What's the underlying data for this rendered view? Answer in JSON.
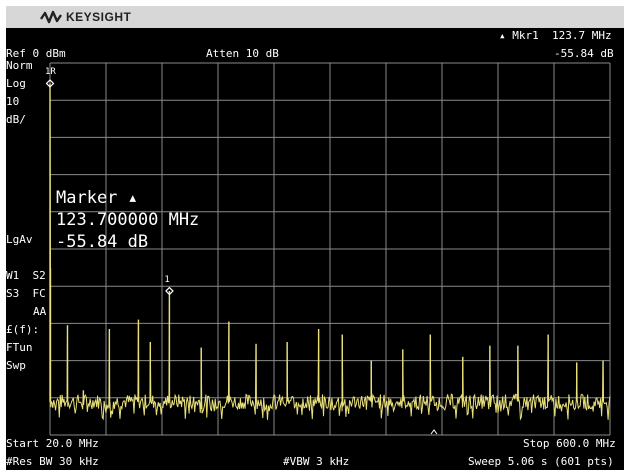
{
  "brand": {
    "name": "KEYSIGHT",
    "logo_icon": "keysight-wave-icon"
  },
  "header": {
    "ref": "Ref 0 dBm",
    "atten": "Atten 10 dB",
    "marker_readout_freq": "▴ Mkr1  123.7 MHz",
    "marker_readout_level": "-55.84 dB"
  },
  "left_panel": {
    "norm": "Norm",
    "log": "Log",
    "scale_value": "10",
    "scale_unit": "dB/",
    "avg": "LgAv",
    "w1s2": "W1  S2",
    "s3fc": "S3  FC",
    "aa": "AA",
    "ff": "£(f):",
    "ftun": "FTun",
    "swp": "Swp"
  },
  "marker_box": {
    "title": "Marker ▴",
    "freq": "123.700000 MHz",
    "level": "-55.84 dB"
  },
  "markers": [
    {
      "label": "1R",
      "freq_mhz": 20.0,
      "level_db": -5.5
    },
    {
      "label": "1",
      "freq_mhz": 143.7,
      "level_db": -61.3
    }
  ],
  "footer": {
    "start": "Start 20.0 MHz",
    "stop": "Stop 600.0 MHz",
    "rbw": "#Res BW 30 kHz",
    "vbw": "#VBW 3 kHz",
    "sweep": "Sweep 5.06 s (601 pts)"
  },
  "chart_data": {
    "type": "line",
    "x_range_mhz": [
      20,
      600
    ],
    "y_range_dbm": [
      0,
      -100
    ],
    "grid": true,
    "trace_color": "#e8e07a",
    "peaks": [
      {
        "freq_mhz": 20.0,
        "level_dbm": -5.5
      },
      {
        "freq_mhz": 20.5,
        "level_dbm": -55.0
      },
      {
        "freq_mhz": 38.1,
        "level_dbm": -70.5
      },
      {
        "freq_mhz": 54.6,
        "level_dbm": -88.0
      },
      {
        "freq_mhz": 81.5,
        "level_dbm": -71.5
      },
      {
        "freq_mhz": 111.6,
        "level_dbm": -69.0
      },
      {
        "freq_mhz": 123.9,
        "level_dbm": -75.0
      },
      {
        "freq_mhz": 143.7,
        "level_dbm": -61.3
      },
      {
        "freq_mhz": 176.6,
        "level_dbm": -76.5
      },
      {
        "freq_mhz": 205.3,
        "level_dbm": -69.5
      },
      {
        "freq_mhz": 233.4,
        "level_dbm": -75.5
      },
      {
        "freq_mhz": 265.6,
        "level_dbm": -75.0
      },
      {
        "freq_mhz": 298.2,
        "level_dbm": -71.5
      },
      {
        "freq_mhz": 322.7,
        "level_dbm": -73.0
      },
      {
        "freq_mhz": 352.7,
        "level_dbm": -80.0
      },
      {
        "freq_mhz": 385.4,
        "level_dbm": -77.0
      },
      {
        "freq_mhz": 413.9,
        "level_dbm": -73.0
      },
      {
        "freq_mhz": 447.5,
        "level_dbm": -79.0
      },
      {
        "freq_mhz": 475.6,
        "level_dbm": -76.0
      },
      {
        "freq_mhz": 504.6,
        "level_dbm": -76.0
      },
      {
        "freq_mhz": 535.9,
        "level_dbm": -73.0
      },
      {
        "freq_mhz": 565.5,
        "level_dbm": -80.5
      },
      {
        "freq_mhz": 592.8,
        "level_dbm": -80.0
      }
    ],
    "noise_floor_dbm": -91.0
  }
}
